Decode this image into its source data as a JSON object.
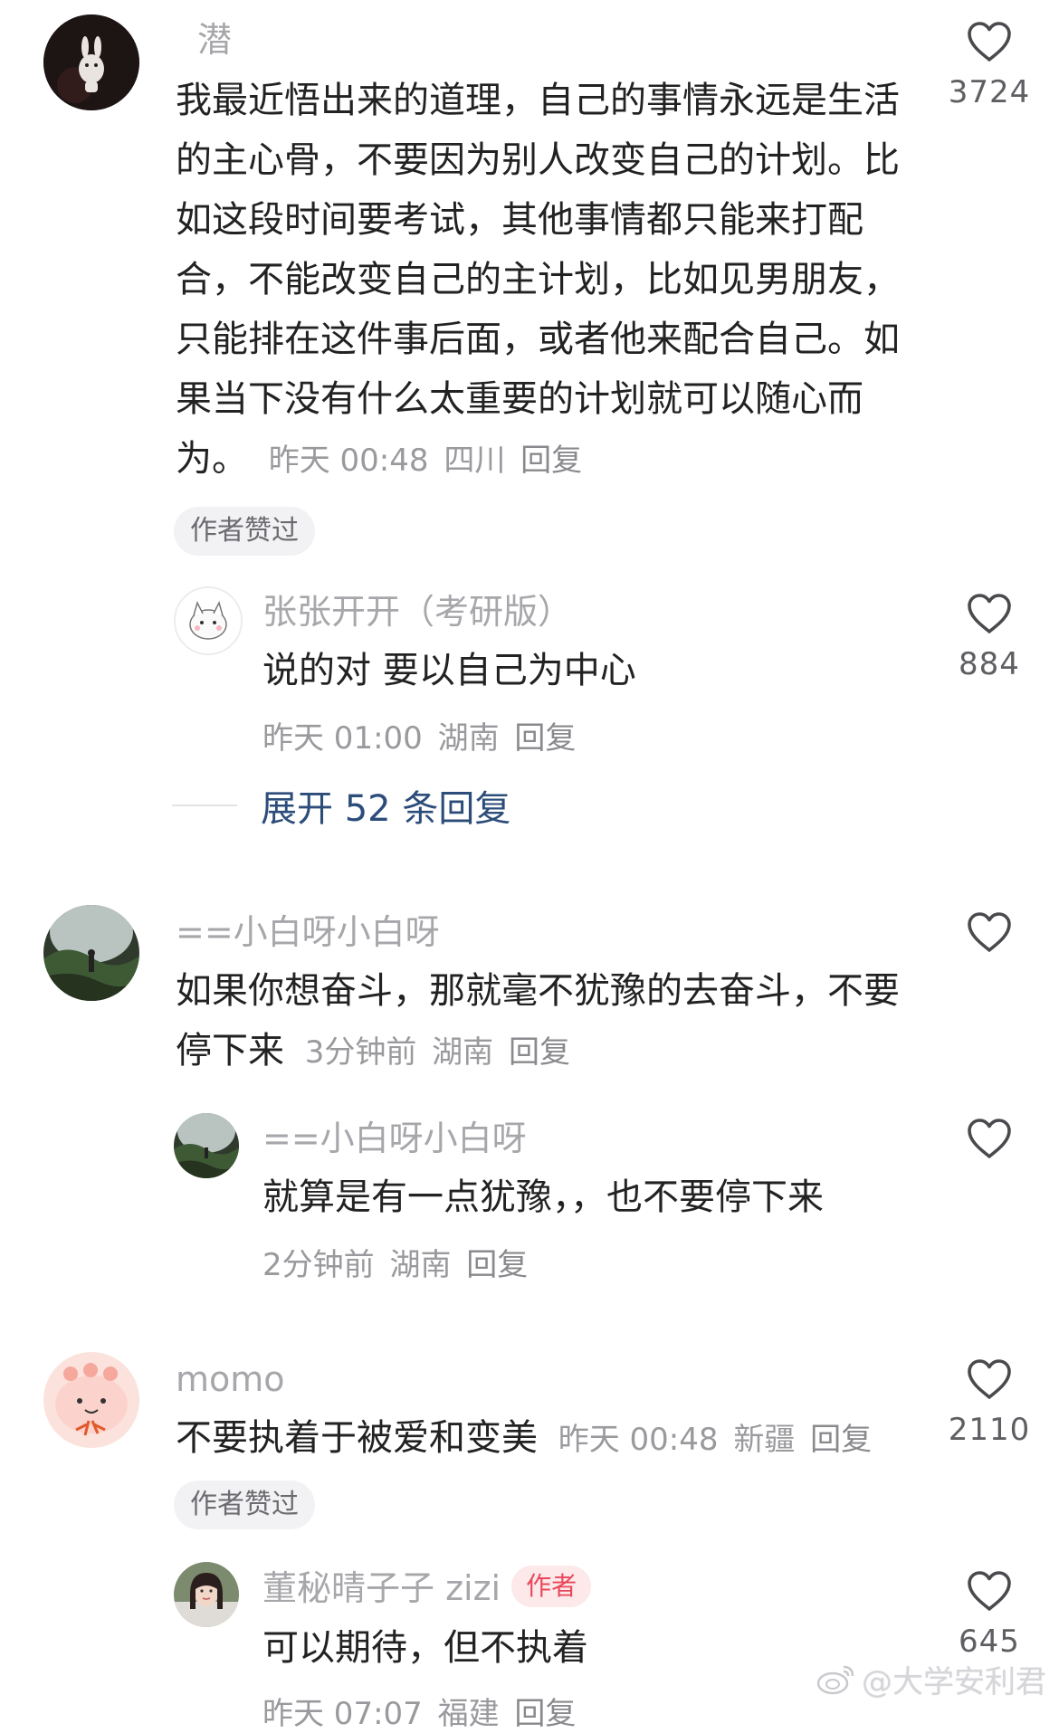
{
  "comments": [
    {
      "name": "潜",
      "text": "我最近悟出来的道理，自己的事情永远是生活的主心骨，不要因为别人改变自己的计划。比如这段时间要考试，其他事情都只能来打配合，不能改变自己的主计划，比如见男朋友，只能排在这件事后面，或者他来配合自己。如果当下没有什么太重要的计划就可以随心而为。",
      "time": "昨天 00:48",
      "location": "四川",
      "reply": "回复",
      "likes": "3724",
      "badge": "作者赞过",
      "replies": [
        {
          "name": "张张开开（考研版）",
          "text": "说的对 要以自己为中心",
          "time": "昨天 01:00",
          "location": "湖南",
          "reply": "回复",
          "likes": "884"
        }
      ],
      "expand": "展开 52 条回复"
    },
    {
      "name": "==小白呀小白呀",
      "text": "如果你想奋斗，那就毫不犹豫的去奋斗，不要停下来",
      "time": "3分钟前",
      "location": "湖南",
      "reply": "回复",
      "likes": "",
      "replies": [
        {
          "name": "==小白呀小白呀",
          "text": "就算是有一点犹豫，，也不要停下来",
          "time": "2分钟前",
          "location": "湖南",
          "reply": "回复",
          "likes": ""
        }
      ]
    },
    {
      "name": "momo",
      "text": "不要执着于被爱和变美",
      "time": "昨天 00:48",
      "location": "新疆",
      "reply": "回复",
      "likes": "2110",
      "badge": "作者赞过",
      "replies": [
        {
          "name": "董秘晴子子 zizi",
          "author_tag": "作者",
          "text": "可以期待，但不执着",
          "time": "昨天 07:07",
          "location": "福建",
          "reply": "回复",
          "likes": "645"
        }
      ]
    }
  ],
  "watermark": "@大学安利君",
  "colors": {
    "name": "#a7a7ab",
    "body": "#222222",
    "meta": "#9a9a9e",
    "expand": "#2c4d7a",
    "author_tag_bg": "#fde8ea",
    "author_tag_text": "#e8485a",
    "chip_bg": "#f2f2f4"
  },
  "icons": {
    "like": "heart-outline-icon",
    "watermark": "weibo-logo-icon"
  }
}
